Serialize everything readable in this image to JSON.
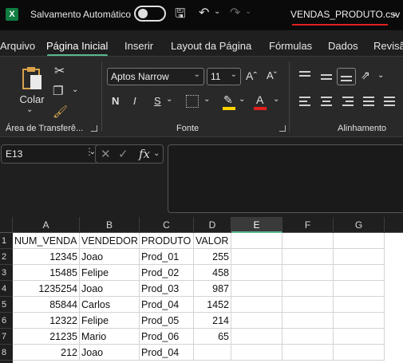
{
  "titlebar": {
    "app_logo": "X",
    "autosave_label": "Salvamento Automático",
    "doc_title": "VENDAS_PRODUTO.csv",
    "icons": [
      "save-icon",
      "undo-icon",
      "redo-icon"
    ]
  },
  "tabs": [
    {
      "label": "Arquivo"
    },
    {
      "label": "Página Inicial"
    },
    {
      "label": "Inserir"
    },
    {
      "label": "Layout da Página"
    },
    {
      "label": "Fórmulas"
    },
    {
      "label": "Dados"
    },
    {
      "label": "Revisã"
    }
  ],
  "ribbon": {
    "paste_label": "Colar",
    "clipboard_group": "Área de Transferê...",
    "font_name": "Aptos Narrow",
    "font_size": "11",
    "bold": "N",
    "italic": "I",
    "underline": "S",
    "font_group": "Fonte",
    "alignment_group": "Alinhamento",
    "accent_color": "#5ab88f",
    "highlight_color": "#ffd400",
    "font_color": "#e02020"
  },
  "formula_bar": {
    "name_box": "E13",
    "fx_label": "fx",
    "formula": ""
  },
  "sheet": {
    "columns": [
      "A",
      "B",
      "C",
      "D",
      "E",
      "F",
      "G"
    ],
    "selected_column": "E",
    "row_numbers": [
      "1",
      "2",
      "3",
      "4",
      "5",
      "6",
      "7",
      "8"
    ],
    "rows": [
      [
        "NUM_VENDA",
        "VENDEDOR",
        "PRODUTO",
        "VALOR"
      ],
      [
        "12345",
        "Joao",
        "Prod_01",
        "255"
      ],
      [
        "15485",
        "Felipe",
        "Prod_02",
        "458"
      ],
      [
        "1235254",
        "Joao",
        "Prod_03",
        "987"
      ],
      [
        "85844",
        "Carlos",
        "Prod_04",
        "1452"
      ],
      [
        "12322",
        "Felipe",
        "Prod_05",
        "214"
      ],
      [
        "21235",
        "Mario",
        "Prod_06",
        "65"
      ],
      [
        "212",
        "Joao",
        "Prod_04",
        ""
      ]
    ]
  }
}
